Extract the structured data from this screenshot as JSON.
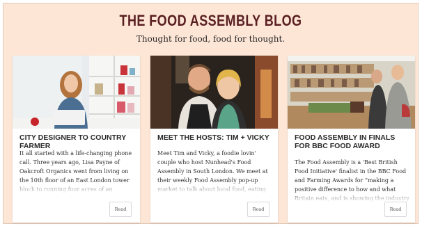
{
  "header": {
    "title": "THE FOOD ASSEMBLY BLOG",
    "tagline": "Thought for food, food for thought."
  },
  "colors": {
    "page_background": "#fde6d6",
    "title_color": "#5a1f22"
  },
  "cards": [
    {
      "title": "CITY DESIGNER TO COUNTRY FARMER",
      "excerpt": "It all started with a life-changing phone call. Three years ago, Lisa Payne of Oakcroft Organics went from living on the 10th floor of an East London tower block to running four acres of an organic garden in rural Cheshire.",
      "button_label": "Read"
    },
    {
      "title": "MEET THE HOSTS: TIM + VICKY",
      "excerpt": "Meet Tim and Vicky, a foodie lovin' couple who host Nunhead's Food Assembly in South London. We meet at their weekly Food Assembly pop-up market to talk about local food, eating better, and food names.",
      "button_label": "Read"
    },
    {
      "title": "FOOD ASSEMBLY IN FINALS FOR BBC FOOD AWARD",
      "excerpt": "The Food Assembly is a 'Best British Food Initiative' finalist in the BBC Food and Farming Awards for “making a positive difference to how and what Britain eats, and is showing the industry the way.",
      "button_label": "Read"
    }
  ]
}
